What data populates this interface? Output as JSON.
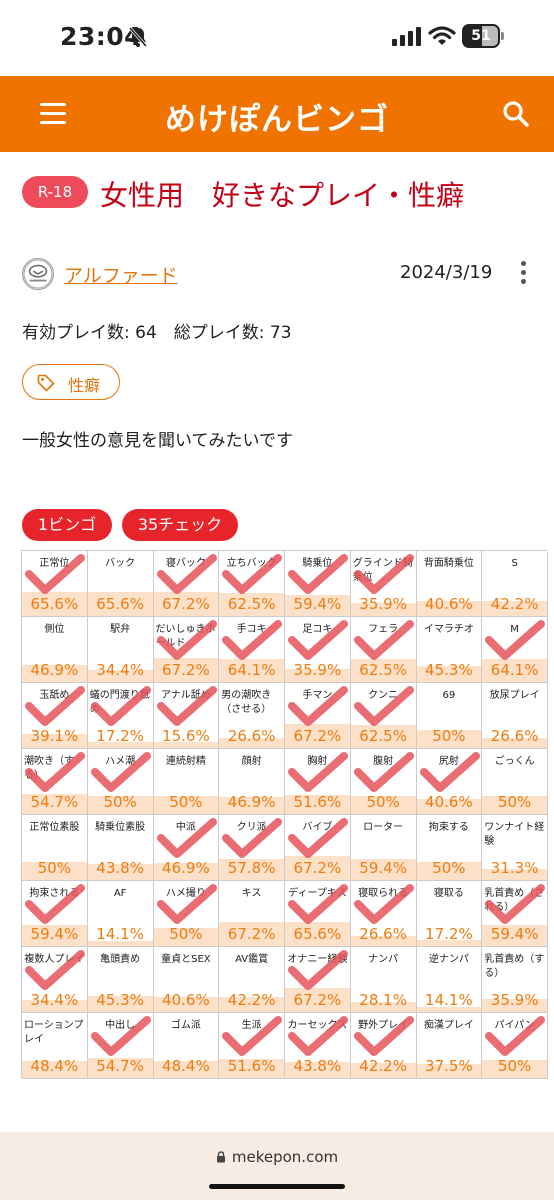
{
  "status_bar": {
    "time": "23:04",
    "battery": "51"
  },
  "header": {
    "logo": "めけぽんビンゴ"
  },
  "post": {
    "badge": "R-18",
    "title": "女性用　好きなプレイ・性癖",
    "author": "アルファード",
    "date": "2024/3/19",
    "play_count": "有効プレイ数: 64　総プレイ数: 73",
    "tag": "性癖",
    "description": "一般女性の意見を聞いてみたいです"
  },
  "result": {
    "bingo": "1ビンゴ",
    "checks": "35チェック"
  },
  "colors": {
    "brand": "#f07300",
    "check": "#e8545c",
    "pill": "#e8242b",
    "percent": "#f07c0f",
    "bar": "#fce0c8"
  },
  "bingo_cells": [
    {
      "label": "正常位",
      "pct": "65.6%",
      "value": 65.6,
      "checked": true
    },
    {
      "label": "バック",
      "pct": "65.6%",
      "value": 65.6,
      "checked": false
    },
    {
      "label": "寝バック",
      "pct": "67.2%",
      "value": 67.2,
      "checked": true
    },
    {
      "label": "立ちバック",
      "pct": "62.5%",
      "value": 62.5,
      "checked": true
    },
    {
      "label": "騎乗位",
      "pct": "59.4%",
      "value": 59.4,
      "checked": true
    },
    {
      "label": "グラインド騎乗位",
      "pct": "35.9%",
      "value": 35.9,
      "checked": true
    },
    {
      "label": "背面騎乗位",
      "pct": "40.6%",
      "value": 40.6,
      "checked": false
    },
    {
      "label": "S",
      "pct": "42.2%",
      "value": 42.2,
      "checked": false
    },
    {
      "label": "側位",
      "pct": "46.9%",
      "value": 46.9,
      "checked": false
    },
    {
      "label": "駅弁",
      "pct": "34.4%",
      "value": 34.4,
      "checked": false
    },
    {
      "label": "だいしゅきホールド",
      "pct": "67.2%",
      "value": 67.2,
      "checked": true
    },
    {
      "label": "手コキ",
      "pct": "64.1%",
      "value": 64.1,
      "checked": true
    },
    {
      "label": "足コキ",
      "pct": "35.9%",
      "value": 35.9,
      "checked": true
    },
    {
      "label": "フェラ",
      "pct": "62.5%",
      "value": 62.5,
      "checked": true
    },
    {
      "label": "イマラチオ",
      "pct": "45.3%",
      "value": 45.3,
      "checked": false
    },
    {
      "label": "M",
      "pct": "64.1%",
      "value": 64.1,
      "checked": true
    },
    {
      "label": "玉舐め",
      "pct": "39.1%",
      "value": 39.1,
      "checked": true
    },
    {
      "label": "蟻の門渡り舐め",
      "pct": "17.2%",
      "value": 17.2,
      "checked": true
    },
    {
      "label": "アナル舐め",
      "pct": "15.6%",
      "value": 15.6,
      "checked": true
    },
    {
      "label": "男の潮吹き（させる）",
      "pct": "26.6%",
      "value": 26.6,
      "checked": false
    },
    {
      "label": "手マン",
      "pct": "67.2%",
      "value": 67.2,
      "checked": true
    },
    {
      "label": "クンニ",
      "pct": "62.5%",
      "value": 62.5,
      "checked": true
    },
    {
      "label": "69",
      "pct": "50%",
      "value": 50,
      "checked": false
    },
    {
      "label": "放尿プレイ",
      "pct": "26.6%",
      "value": 26.6,
      "checked": false
    },
    {
      "label": "潮吹き（する）",
      "pct": "54.7%",
      "value": 54.7,
      "checked": true
    },
    {
      "label": "ハメ潮",
      "pct": "50%",
      "value": 50,
      "checked": true
    },
    {
      "label": "連続射精",
      "pct": "50%",
      "value": 50,
      "checked": false
    },
    {
      "label": "顔射",
      "pct": "46.9%",
      "value": 46.9,
      "checked": false
    },
    {
      "label": "胸射",
      "pct": "51.6%",
      "value": 51.6,
      "checked": true
    },
    {
      "label": "腹射",
      "pct": "50%",
      "value": 50,
      "checked": true
    },
    {
      "label": "尻射",
      "pct": "40.6%",
      "value": 40.6,
      "checked": true
    },
    {
      "label": "ごっくん",
      "pct": "50%",
      "value": 50,
      "checked": false
    },
    {
      "label": "正常位素股",
      "pct": "50%",
      "value": 50,
      "checked": false
    },
    {
      "label": "騎乗位素股",
      "pct": "43.8%",
      "value": 43.8,
      "checked": false
    },
    {
      "label": "中派",
      "pct": "46.9%",
      "value": 46.9,
      "checked": true
    },
    {
      "label": "クリ派",
      "pct": "57.8%",
      "value": 57.8,
      "checked": true
    },
    {
      "label": "バイブ",
      "pct": "67.2%",
      "value": 67.2,
      "checked": true
    },
    {
      "label": "ローター",
      "pct": "59.4%",
      "value": 59.4,
      "checked": false
    },
    {
      "label": "拘束する",
      "pct": "50%",
      "value": 50,
      "checked": false
    },
    {
      "label": "ワンナイト経験",
      "pct": "31.3%",
      "value": 31.3,
      "checked": false
    },
    {
      "label": "拘束される",
      "pct": "59.4%",
      "value": 59.4,
      "checked": true
    },
    {
      "label": "AF",
      "pct": "14.1%",
      "value": 14.1,
      "checked": false
    },
    {
      "label": "ハメ撮り",
      "pct": "50%",
      "value": 50,
      "checked": true
    },
    {
      "label": "キス",
      "pct": "67.2%",
      "value": 67.2,
      "checked": false
    },
    {
      "label": "ディープキス",
      "pct": "65.6%",
      "value": 65.6,
      "checked": true
    },
    {
      "label": "寝取られる",
      "pct": "26.6%",
      "value": 26.6,
      "checked": true
    },
    {
      "label": "寝取る",
      "pct": "17.2%",
      "value": 17.2,
      "checked": false
    },
    {
      "label": "乳首責め（される）",
      "pct": "59.4%",
      "value": 59.4,
      "checked": true
    },
    {
      "label": "複数人プレイ",
      "pct": "34.4%",
      "value": 34.4,
      "checked": true
    },
    {
      "label": "亀頭責め",
      "pct": "45.3%",
      "value": 45.3,
      "checked": false
    },
    {
      "label": "童貞とSEX",
      "pct": "40.6%",
      "value": 40.6,
      "checked": false
    },
    {
      "label": "AV鑑賞",
      "pct": "42.2%",
      "value": 42.2,
      "checked": false
    },
    {
      "label": "オナニー経験",
      "pct": "67.2%",
      "value": 67.2,
      "checked": true
    },
    {
      "label": "ナンパ",
      "pct": "28.1%",
      "value": 28.1,
      "checked": false
    },
    {
      "label": "逆ナンパ",
      "pct": "14.1%",
      "value": 14.1,
      "checked": false
    },
    {
      "label": "乳首責め（する）",
      "pct": "35.9%",
      "value": 35.9,
      "checked": false
    },
    {
      "label": "ローションプレイ",
      "pct": "48.4%",
      "value": 48.4,
      "checked": false
    },
    {
      "label": "中出し",
      "pct": "54.7%",
      "value": 54.7,
      "checked": true
    },
    {
      "label": "ゴム派",
      "pct": "48.4%",
      "value": 48.4,
      "checked": false
    },
    {
      "label": "生派",
      "pct": "51.6%",
      "value": 51.6,
      "checked": true
    },
    {
      "label": "カーセックス",
      "pct": "43.8%",
      "value": 43.8,
      "checked": true
    },
    {
      "label": "野外プレイ",
      "pct": "42.2%",
      "value": 42.2,
      "checked": true
    },
    {
      "label": "痴漢プレイ",
      "pct": "37.5%",
      "value": 37.5,
      "checked": false
    },
    {
      "label": "パイパン",
      "pct": "50%",
      "value": 50,
      "checked": true
    }
  ],
  "browser": {
    "url": "mekepon.com"
  }
}
